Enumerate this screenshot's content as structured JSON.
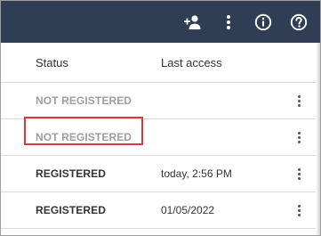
{
  "toolbar": {
    "icons": [
      "add-user-icon",
      "more-vert-icon",
      "info-icon",
      "help-icon"
    ]
  },
  "table": {
    "columns": {
      "status": "Status",
      "last_access": "Last access"
    },
    "rows": [
      {
        "status": "NOT REGISTERED",
        "last_access": "",
        "style": "muted"
      },
      {
        "status": "NOT REGISTERED",
        "last_access": "",
        "style": "muted"
      },
      {
        "status": "REGISTERED",
        "last_access": "today, 2:56 PM",
        "style": "strong"
      },
      {
        "status": "REGISTERED",
        "last_access": "01/05/2022",
        "style": "strong"
      }
    ]
  },
  "colors": {
    "topbar": "#2f3e55",
    "highlight": "#d93a3a",
    "muted_text": "#9e9e9e"
  }
}
